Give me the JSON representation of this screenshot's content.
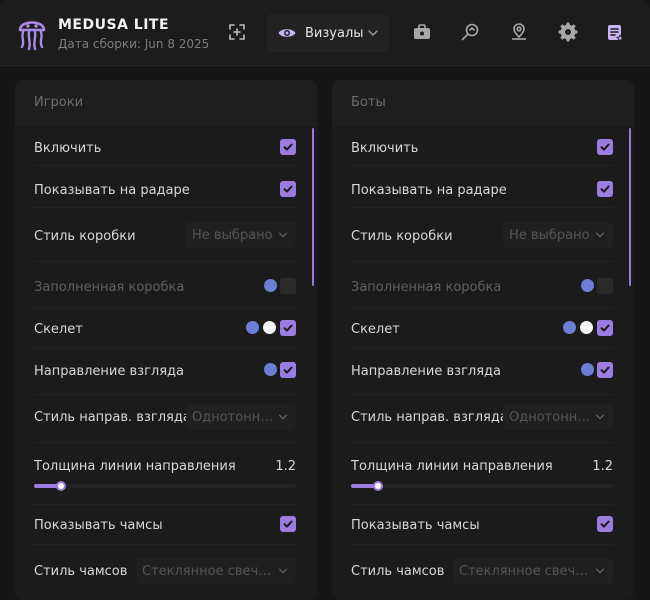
{
  "app": {
    "title": "MEDUSA LITE",
    "build": "Дата сборки: Jun 8 2025",
    "accent": "#9b7ce0"
  },
  "nav": {
    "active_tab": "Визуалы",
    "icons": [
      "crosshair-icon",
      "eye-icon",
      "briefcase-icon",
      "search-radar-icon",
      "map-pin-icon",
      "gear-icon",
      "config-list-icon"
    ]
  },
  "panels": [
    {
      "title": "Игроки",
      "enable": "Включить",
      "show_radar": "Показывать на радаре",
      "box_style": {
        "label": "Стиль коробки",
        "value": "Не выбрано"
      },
      "filled_box": "Заполненная коробка",
      "skeleton": "Скелет",
      "view_dir": "Направление взгляда",
      "view_dir_style": {
        "label": "Стиль направ. взгляда",
        "value": "Однотонн?.."
      },
      "line_thickness": {
        "label": "Толщина линии направления",
        "value": "1.2",
        "fraction": 0.09
      },
      "show_chams": "Показывать чамсы",
      "chams_style": {
        "label": "Стиль чамсов",
        "value": "Стеклянное свечен..."
      }
    },
    {
      "title": "Боты",
      "enable": "Включить",
      "show_radar": "Показывать на радаре",
      "box_style": {
        "label": "Стиль коробки",
        "value": "Не выбрано"
      },
      "filled_box": "Заполненная коробка",
      "skeleton": "Скелет",
      "view_dir": "Направление взгляда",
      "view_dir_style": {
        "label": "Стиль направ. взгляда",
        "value": "Однотонн?.."
      },
      "line_thickness": {
        "label": "Толщина линии направления",
        "value": "1.2",
        "fraction": 0.09
      },
      "show_chams": "Показывать чамсы",
      "chams_style": {
        "label": "Стиль чамсов",
        "value": "Стеклянное свечен..."
      }
    }
  ],
  "colors": {
    "dot_blue": "#6b7fd6",
    "dot_white": "#f4f4f4"
  }
}
